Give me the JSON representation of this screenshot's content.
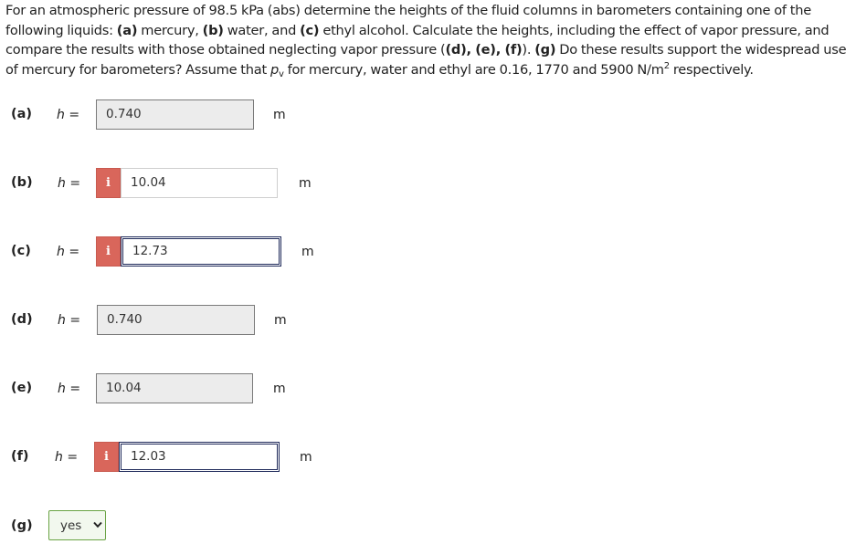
{
  "question": {
    "seg1": "For an atmospheric pressure of 98.5 kPa (abs) determine the heights of the fluid columns in barometers containing one of the following liquids: ",
    "a_tag": "(a)",
    "seg2": " mercury, ",
    "b_tag": "(b)",
    "seg3": " water, and ",
    "c_tag": "(c)",
    "seg4": " ethyl alcohol. Calculate the heights, including the effect of vapor pressure, and compare the results with those obtained neglecting vapor pressure (",
    "def_tag": "(d), (e), (f)",
    "seg5": "). ",
    "g_tag": "(g)",
    "seg6": " Do these results support the widespread use of mercury for barometers? Assume that ",
    "p_symbol": "p",
    "p_sub": "v",
    "seg7": " for mercury, water and ethyl are 0.16, 1770 and 5900 N/m",
    "exp": "2",
    "seg8": " respectively."
  },
  "h_symbol": "h",
  "h_equals": " =",
  "parts": [
    {
      "label": "(a)",
      "value": "0.740",
      "unit": "m",
      "style": "correct",
      "info": false
    },
    {
      "label": "(b)",
      "value": "10.04",
      "unit": "m",
      "style": "plain",
      "info": true
    },
    {
      "label": "(c)",
      "value": "12.73",
      "unit": "m",
      "style": "focus",
      "info": true
    },
    {
      "label": "(d)",
      "value": "0.740",
      "unit": "m",
      "style": "correct",
      "info": false
    },
    {
      "label": "(e)",
      "value": "10.04",
      "unit": "m",
      "style": "correct",
      "info": false
    },
    {
      "label": "(f)",
      "value": "12.03",
      "unit": "m",
      "style": "focus",
      "info": true
    }
  ],
  "info_glyph": "i",
  "part_g": {
    "label": "(g)",
    "selected": "yes",
    "border_color": "#6aa344"
  },
  "colors": {
    "info_badge": "#d9665b",
    "correct_fill": "#ececec",
    "focus_border": "#1f2a5a"
  }
}
